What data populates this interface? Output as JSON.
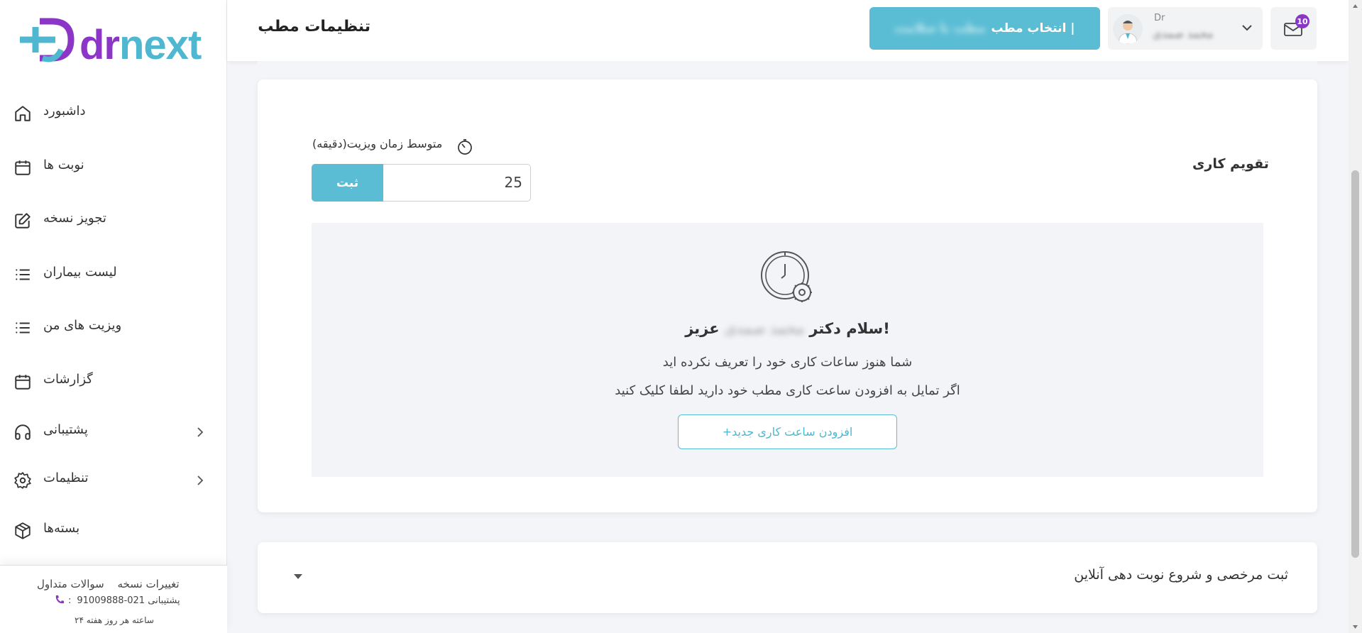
{
  "brand": {
    "logo_dr": "dr",
    "logo_next": "next"
  },
  "header": {
    "page_title": "تنظیمات مطب",
    "clinic_button_label": "انتخاب مطب |",
    "clinic_button_hidden": "مطب با سلامت",
    "user_prefix": "Dr",
    "user_name": "محمد صمدی",
    "notifications_count": "10"
  },
  "sidebar": {
    "items": [
      {
        "label": "داشبورد",
        "icon": "home-icon"
      },
      {
        "label": "نوبت ها",
        "icon": "calendar-icon"
      },
      {
        "label": "تجویز نسخه",
        "icon": "edit-icon"
      },
      {
        "label": "لیست بیماران",
        "icon": "list-icon"
      },
      {
        "label": "ویزیت های من",
        "icon": "list-icon"
      },
      {
        "label": "گزارشات",
        "icon": "calendar-icon"
      },
      {
        "label": "پشتیبانی",
        "icon": "headphones-icon"
      },
      {
        "label": "تنظیمات",
        "icon": "gear-icon"
      },
      {
        "label": "بسته‌ها",
        "icon": "package-icon"
      }
    ],
    "footer": {
      "faq": "سوالات متداول",
      "changelog": "تغییرات نسخه",
      "support_phone": "021-91009888",
      "support_label": ":پشتیبانی",
      "hours": "۲۴ ساعته هر روز هفته"
    }
  },
  "main": {
    "section_title": "تقویم کاری",
    "avg_visit_label": "متوسط زمان ویزیت(دقیقه)",
    "avg_visit_value": "25",
    "submit_label": "ثبت",
    "greeting_prefix": "سلام دکتر",
    "greeting_name": "محمد صمدی",
    "greeting_suffix": "عزیز!",
    "message_line1": "شما هنوز ساعات کاری خود را تعریف نکرده اید",
    "message_line2": "اگر تمایل به افزودن ساعت کاری مطب خود دارید لطفا کلیک کنید",
    "add_button_label": "+افزودن ساعت کاری جدید"
  },
  "collapsed_section": {
    "title": "ثبت مرخصی و شروع نوبت دهی آنلاین"
  },
  "colors": {
    "accent": "#5bbdd4",
    "brand_purple": "#8b36c7"
  }
}
